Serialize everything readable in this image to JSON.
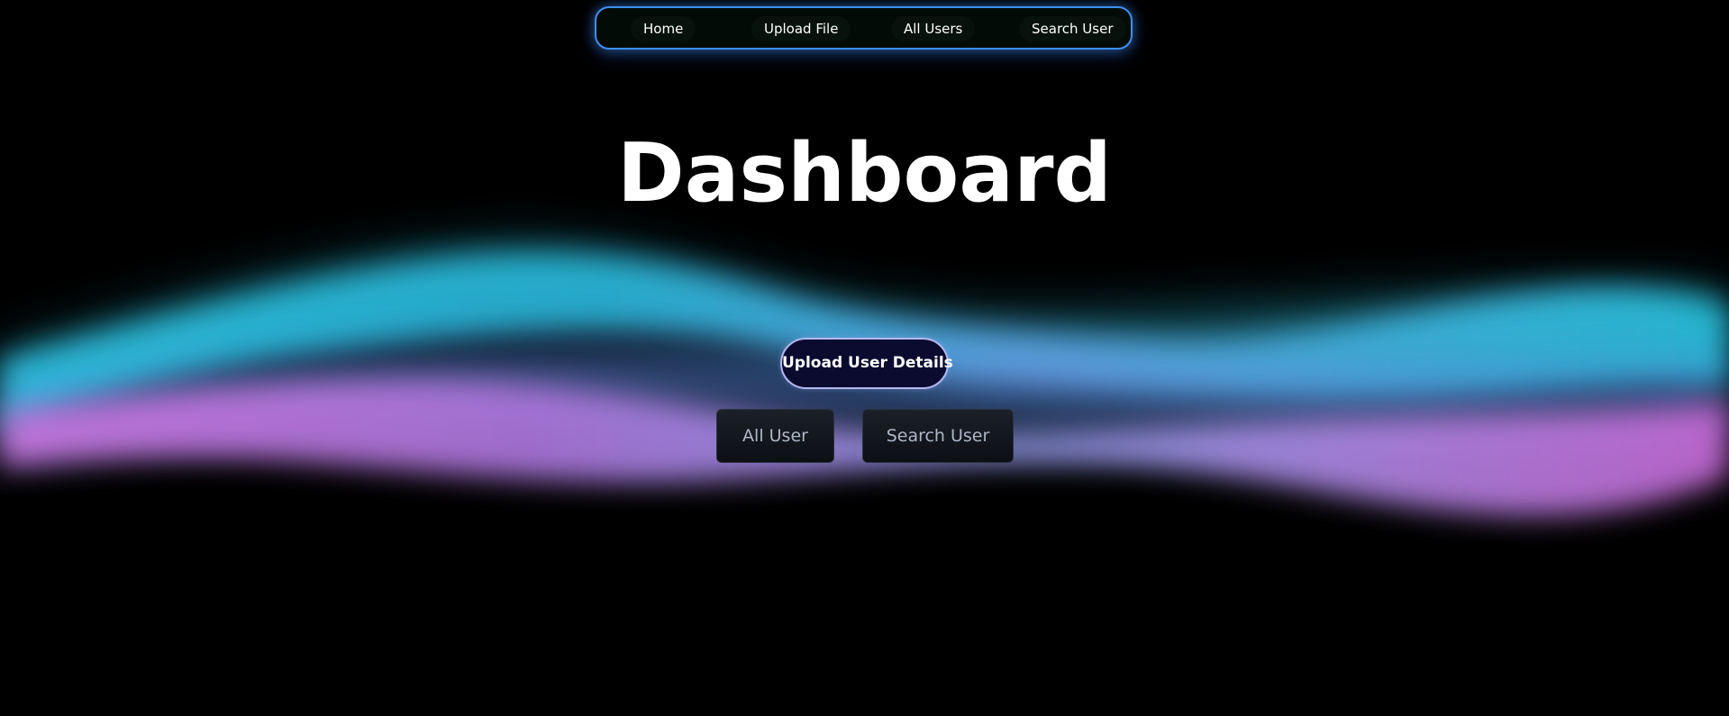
{
  "nav": {
    "items": [
      {
        "label": "Home"
      },
      {
        "label": "Upload File"
      },
      {
        "label": "All Users"
      },
      {
        "label": "Search User"
      }
    ]
  },
  "main": {
    "title": "Dashboard",
    "upload_button_label": "Upload User Details",
    "all_user_button_label": "All User",
    "search_user_button_label": "Search User"
  },
  "theme": {
    "background": "#000000",
    "nav_border": "#3f8ff0",
    "wave_cyan": "#29c2dd",
    "wave_blue": "#5b8fe8",
    "wave_magenta": "#d173e6",
    "primary_button_background": "#0b0b30"
  }
}
